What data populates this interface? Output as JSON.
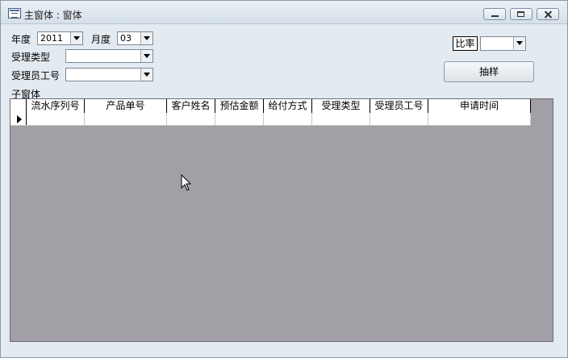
{
  "window": {
    "title": "主窗体 : 窗体"
  },
  "form": {
    "year_label": "年度",
    "year_value": "2011",
    "month_label": "月度",
    "month_value": "03",
    "accept_type_label": "受理类型",
    "accept_type_value": "",
    "operator_id_label": "受理员工号",
    "operator_id_value": "",
    "ratio_label": "比率",
    "ratio_value": "",
    "sample_button_label": "抽样",
    "subform_label": "子窗体"
  },
  "subform": {
    "columns": [
      "流水序列号",
      "产品单号",
      "客户姓名",
      "预估金额",
      "给付方式",
      "受理类型",
      "受理员工号",
      "申请时间"
    ],
    "rows": [
      {
        "cells": [
          "",
          "",
          "",
          "",
          "",
          "",
          "",
          ""
        ]
      }
    ]
  }
}
